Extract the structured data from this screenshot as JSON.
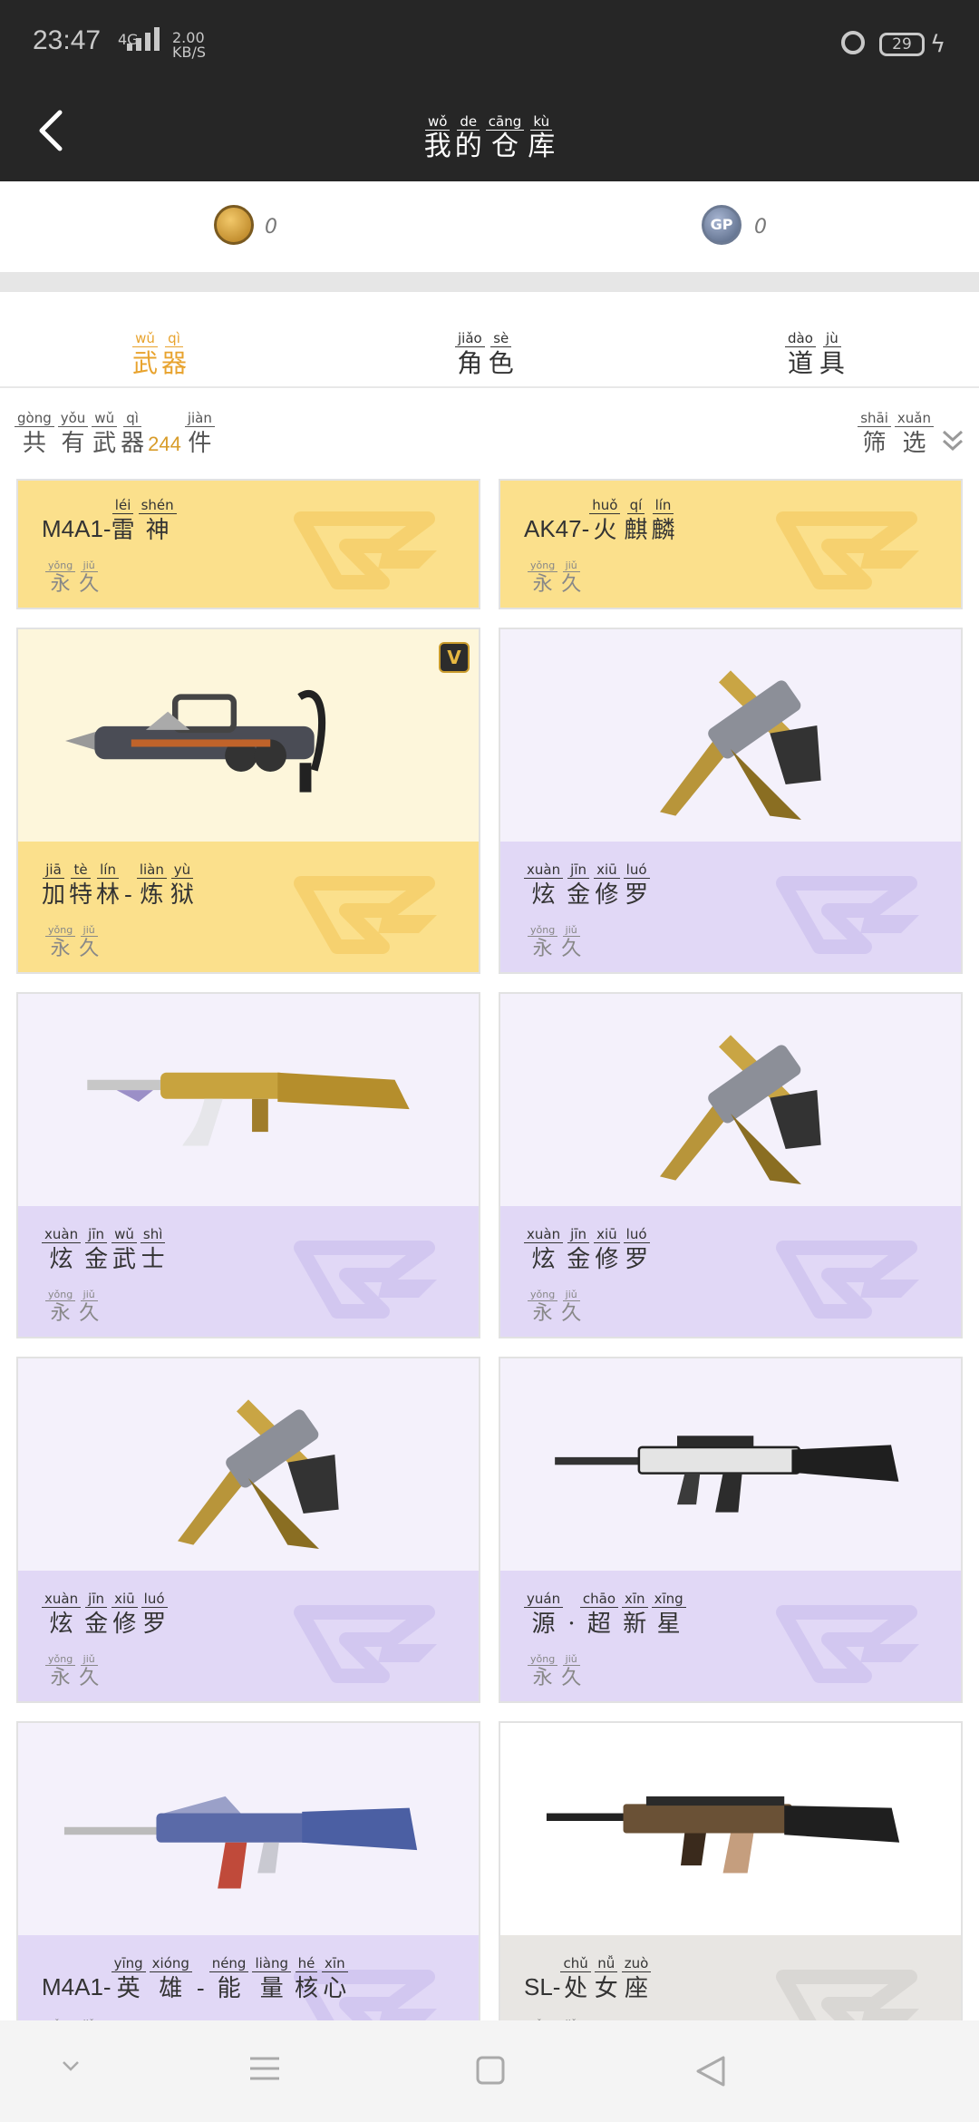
{
  "status": {
    "time": "23:47",
    "net": "4G",
    "speed_val": "2.00",
    "speed_unit": "KB/S",
    "battery": "29"
  },
  "header": {
    "title": [
      {
        "py": "wǒ",
        "hz": "我"
      },
      {
        "py": "de",
        "hz": "的"
      },
      {
        "py": "cāng",
        "hz": "仓"
      },
      {
        "py": "kù",
        "hz": "库"
      }
    ]
  },
  "currency": {
    "cf_value": "0",
    "gp_label": "GP",
    "gp_value": "0"
  },
  "tabs": [
    [
      {
        "py": "wǔ",
        "hz": "武"
      },
      {
        "py": "qì",
        "hz": "器"
      }
    ],
    [
      {
        "py": "jiǎo",
        "hz": "角"
      },
      {
        "py": "sè",
        "hz": "色"
      }
    ],
    [
      {
        "py": "dào",
        "hz": "道"
      },
      {
        "py": "jù",
        "hz": "具"
      }
    ]
  ],
  "count": {
    "prefix": [
      {
        "py": "gòng",
        "hz": "共"
      },
      {
        "py": "yǒu",
        "hz": "有"
      },
      {
        "py": "wǔ",
        "hz": "武"
      },
      {
        "py": "qì",
        "hz": "器"
      }
    ],
    "number": "244",
    "suffix": [
      {
        "py": "jiàn",
        "hz": "件"
      }
    ],
    "filter": [
      {
        "py": "shāi",
        "hz": "筛"
      },
      {
        "py": "xuǎn",
        "hz": "选"
      }
    ]
  },
  "duration": [
    {
      "py": "yǒng",
      "hz": "永"
    },
    {
      "py": "jiǔ",
      "hz": "久"
    }
  ],
  "weapons": [
    {
      "prefix": "M4A1-",
      "name": [
        {
          "py": "léi",
          "hz": "雷"
        },
        {
          "py": "shén",
          "hz": "神"
        }
      ],
      "theme": "gold",
      "art": "none"
    },
    {
      "prefix": "AK47-",
      "name": [
        {
          "py": "huǒ",
          "hz": "火"
        },
        {
          "py": "qí",
          "hz": "麒"
        },
        {
          "py": "lín",
          "hz": "麟"
        }
      ],
      "theme": "gold",
      "art": "none"
    },
    {
      "prefix": "",
      "name": [
        {
          "py": "jiā",
          "hz": "加"
        },
        {
          "py": "tè",
          "hz": "特"
        },
        {
          "py": "lín",
          "hz": "林"
        },
        {
          "py": "",
          "hz": "-"
        },
        {
          "py": "liàn",
          "hz": "炼"
        },
        {
          "py": "yù",
          "hz": "狱"
        }
      ],
      "theme": "gold",
      "art": "gatling",
      "badge": "V"
    },
    {
      "prefix": "",
      "name": [
        {
          "py": "xuàn",
          "hz": "炫"
        },
        {
          "py": "jīn",
          "hz": "金"
        },
        {
          "py": "xiū",
          "hz": "修"
        },
        {
          "py": "luó",
          "hz": "罗"
        }
      ],
      "theme": "purple",
      "art": "pistol"
    },
    {
      "prefix": "",
      "name": [
        {
          "py": "xuàn",
          "hz": "炫"
        },
        {
          "py": "jīn",
          "hz": "金"
        },
        {
          "py": "wǔ",
          "hz": "武"
        },
        {
          "py": "shì",
          "hz": "士"
        }
      ],
      "theme": "purple",
      "art": "ak"
    },
    {
      "prefix": "",
      "name": [
        {
          "py": "xuàn",
          "hz": "炫"
        },
        {
          "py": "jīn",
          "hz": "金"
        },
        {
          "py": "xiū",
          "hz": "修"
        },
        {
          "py": "luó",
          "hz": "罗"
        }
      ],
      "theme": "purple",
      "art": "pistol"
    },
    {
      "prefix": "",
      "name": [
        {
          "py": "xuàn",
          "hz": "炫"
        },
        {
          "py": "jīn",
          "hz": "金"
        },
        {
          "py": "xiū",
          "hz": "修"
        },
        {
          "py": "luó",
          "hz": "罗"
        }
      ],
      "theme": "purple",
      "art": "pistol"
    },
    {
      "prefix": "",
      "name": [
        {
          "py": "yuán",
          "hz": "源"
        },
        {
          "py": "",
          "hz": "·"
        },
        {
          "py": "chāo",
          "hz": "超"
        },
        {
          "py": "xīn",
          "hz": "新"
        },
        {
          "py": "xīng",
          "hz": "星"
        }
      ],
      "theme": "purple",
      "art": "rifle"
    },
    {
      "prefix": "M4A1-",
      "name": [
        {
          "py": "yīng",
          "hz": "英"
        },
        {
          "py": "xióng",
          "hz": "雄"
        },
        {
          "py": "",
          "hz": "-"
        },
        {
          "py": "néng",
          "hz": "能"
        },
        {
          "py": "liàng",
          "hz": "量"
        },
        {
          "py": "hé",
          "hz": "核"
        },
        {
          "py": "xīn",
          "hz": "心"
        }
      ],
      "theme": "purple",
      "art": "m4"
    },
    {
      "prefix": "SL-",
      "name": [
        {
          "py": "chǔ",
          "hz": "处"
        },
        {
          "py": "nǚ",
          "hz": "女"
        },
        {
          "py": "zuò",
          "hz": "座"
        }
      ],
      "theme": "gray",
      "art": "scar"
    }
  ],
  "colors": {
    "accent": "#e8a32e",
    "gold_band": "#fbe08c",
    "purple_band": "#e1d8f6",
    "header_bg": "#262626"
  }
}
